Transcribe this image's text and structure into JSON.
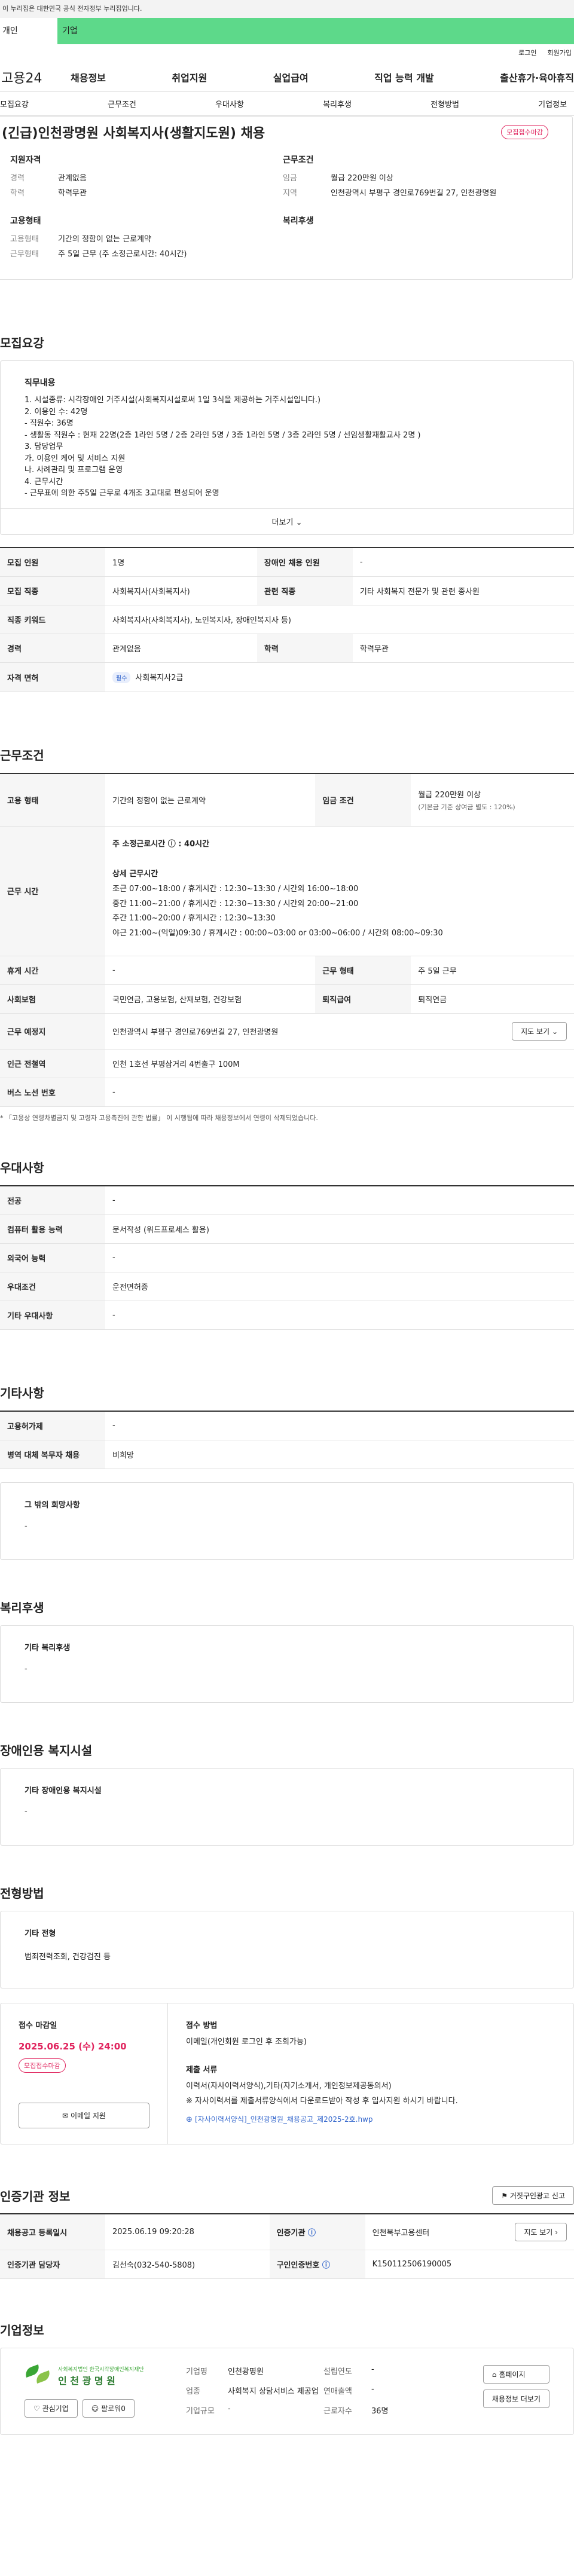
{
  "gov_banner": "이 누리집은 대한민국 공식 전자정부 누리집입니다.",
  "strip": {
    "left": "개인",
    "right": "기업"
  },
  "util": {
    "login": "로그인",
    "join": "회원가입"
  },
  "gnb": {
    "logo": "고용24",
    "menu": [
      "채용정보",
      "취업지원",
      "실업급여",
      "직업 능력 개발",
      "출산휴가·육아휴직"
    ]
  },
  "tabs": [
    "모집요강",
    "근무조건",
    "우대사항",
    "복리후생",
    "전형방법",
    "기업정보"
  ],
  "title": "(긴급)인천광명원 사회복지사(생활지도원) 채용",
  "status_badge": "모집접수마감",
  "summary": {
    "qual_h": "지원자격",
    "career_k": "경력",
    "career_v": "관계없음",
    "edu_k": "학력",
    "edu_v": "학력무관",
    "work_h": "근무조건",
    "wage_k": "임금",
    "wage_v": "월급 220만원 이상",
    "area_k": "지역",
    "area_v": "인천광역시 부평구 경인로769번길 27, 인천광명원",
    "emp_h": "고용형태",
    "emp_k": "고용형태",
    "emp_v": "기간의 정함이 없는 근로계약",
    "hours_k": "근무형태",
    "hours_v": "주 5일 근무 (주 소정근로시간: 40시간)",
    "welfare_h": "복리후생"
  },
  "sec": {
    "recruit": "모집요강",
    "work": "근무조건",
    "pref": "우대사항",
    "etc": "기타사항",
    "welfare": "복리후생",
    "disab": "장애인용 복지시설",
    "select": "전형방법",
    "cert": "인증기관 정보",
    "company": "기업정보"
  },
  "duty": {
    "h": "직무내용",
    "text": "1. 시설종류: 시각장애인 거주시설(사회복지시설로써 1일 3식을 제공하는 거주시설입니다.)\n2. 이용인 수: 42명\n - 직원수: 36명\n - 생활동 직원수 : 현재 22명(2층 1라인 5명 / 2층 2라인 5명 / 3층 1라인 5명 / 3층 2라인 5명 / 선임생활재활교사 2명 )\n3. 담당업무\n가. 이용인 케어 및 서비스 지원\n나. 사례관리 및 프로그램 운영\n4. 근무시간\n - 근무표에 의한 주5일 근무로 4개조 3교대로 편성되어 운영",
    "more": "더보기"
  },
  "rec_table": [
    {
      "k1": "모집 인원",
      "v1": "1명",
      "k2": "장애인 채용 인원",
      "v2": "-"
    },
    {
      "k1": "모집 직종",
      "v1": "사회복지사(사회복지사)",
      "k2": "관련 직종",
      "v2": "기타 사회복지 전문가 및 관련 종사원"
    },
    {
      "k1": "직종 키워드",
      "v1": "사회복지사(사회복지사), 노인복지사, 장애인복지사 등)"
    },
    {
      "k1": "경력",
      "v1": "관계없음",
      "k2": "학력",
      "v2": "학력무관"
    },
    {
      "k1": "자격 면허",
      "pill": "필수",
      "v1": "사회복지사2급"
    }
  ],
  "work": {
    "emp_k": "고용 형태",
    "emp_v": "기간의 정함이 없는 근로계약",
    "wage_k": "임금 조건",
    "wage_v": "월급 220만원 이상",
    "wage_sub": "(기본금 기준 상여금 별도 : 120%)",
    "time_k": "근무 시간",
    "time_main": "주 소정근로시간 ⓘ : 40시간",
    "time_sub": "상세 근무시간",
    "shifts": [
      "조근 07:00~18:00 / 휴게시간 : 12:30~13:30  / 시간외 16:00~18:00",
      "중간 11:00~21:00 / 휴게시간 : 12:30~13:30  / 시간외 20:00~21:00",
      "주간 11:00~20:00 / 휴게시간 : 12:30~13:30",
      "야근 21:00~(익일)09:30 / 휴게시간 : 00:00~03:00 or 03:00~06:00 / 시간외 08:00~09:30"
    ],
    "rest_k": "휴게 시간",
    "rest_v": "-",
    "type_k": "근무 형태",
    "type_v": "주 5일 근무",
    "ins_k": "사회보험",
    "ins_v": "국민연금, 고용보험, 산재보험, 건강보험",
    "ret_k": "퇴직급여",
    "ret_v": "퇴직연금",
    "place_k": "근무 예정지",
    "place_v": "인천광역시 부평구 경인로769번길 27, 인천광명원",
    "map_btn": "지도 보기",
    "sub_k": "인근 전철역",
    "sub_v": "인천 1호선 부평삼거리 4번출구 100M",
    "bus_k": "버스 노선 번호",
    "bus_v": "-",
    "note": "* 「고용상 연령차별금지 및 고령자 고용촉진에 관한 법률」 이 시행됨에 따라 채용정보에서 연령이 삭제되었습니다."
  },
  "pref": [
    {
      "k": "전공",
      "v": "-"
    },
    {
      "k": "컴퓨터 활용 능력",
      "v": "문서작성 (워드프로세스 활용)"
    },
    {
      "k": "외국어 능력",
      "v": "-"
    },
    {
      "k": "우대조건",
      "v": "운전면허증"
    },
    {
      "k": "기타 우대사항",
      "v": "-"
    }
  ],
  "etc": [
    {
      "k": "고용허가제",
      "v": "-"
    },
    {
      "k": "병역 대체 복무자 채용",
      "v": "비희망"
    }
  ],
  "etc_box": {
    "h": "그 밖의 희망사항",
    "v": "-"
  },
  "welfare_box": {
    "h": "기타 복리후생",
    "v": "-"
  },
  "disab_box": {
    "h": "기타 장애인용 복지시설",
    "v": "-"
  },
  "select_box": {
    "h": "기타 전형",
    "v": "범죄전력조회, 건강검진 등"
  },
  "apply": {
    "deadline_h": "접수 마감일",
    "deadline": "2025.06.25 (수) 24:00",
    "badge": "모집접수마감",
    "email_btn": "이메일 지원",
    "method_h": "접수 방법",
    "method_v": "이메일(개인회원 로그인 후 조회가능)",
    "doc_h": "제출 서류",
    "doc_v": "이력서(자사이력서양식),기타(자기소개서, 개인정보제공동의서)",
    "doc_note": "※ 자사이력서를 제출서류양식에서 다운로드받아 작성 후 입사지원 하시기 바랍니다.",
    "file": "[자사이력서양식]_인천광명원_채용공고_제2025-2호.hwp"
  },
  "cert": {
    "report_btn": "거짓구인광고 신고",
    "r1k": "채용공고 등록일시",
    "r1v": "2025.06.19 09:20:28",
    "r1k2": "인증기관",
    "r1v2": "인천북부고용센터",
    "map_btn": "지도 보기",
    "r2k": "인증기관 담당자",
    "r2v": "김선숙(032-540-5808)",
    "r2k2": "구인인증번호",
    "r2v2": "K150112506190005"
  },
  "company": {
    "logo_sub": "사회복지법인 한국시각장애인복지재단",
    "logo": "인 천 광 명 원",
    "interest": "관심기업",
    "follow": "팔로워0",
    "f": [
      [
        "기업명",
        "인천광명원",
        "설립연도",
        "-"
      ],
      [
        "업종",
        "사회복지 상담서비스 제공업",
        "연매출액",
        "-"
      ],
      [
        "기업규모",
        "-",
        "근로자수",
        "36명"
      ]
    ],
    "home_btn": "홈페이지",
    "more_btn": "채용정보 더보기"
  },
  "colors": {
    "accent": "#5dd98a",
    "badge": "#e0245e",
    "link": "#3366cc"
  }
}
